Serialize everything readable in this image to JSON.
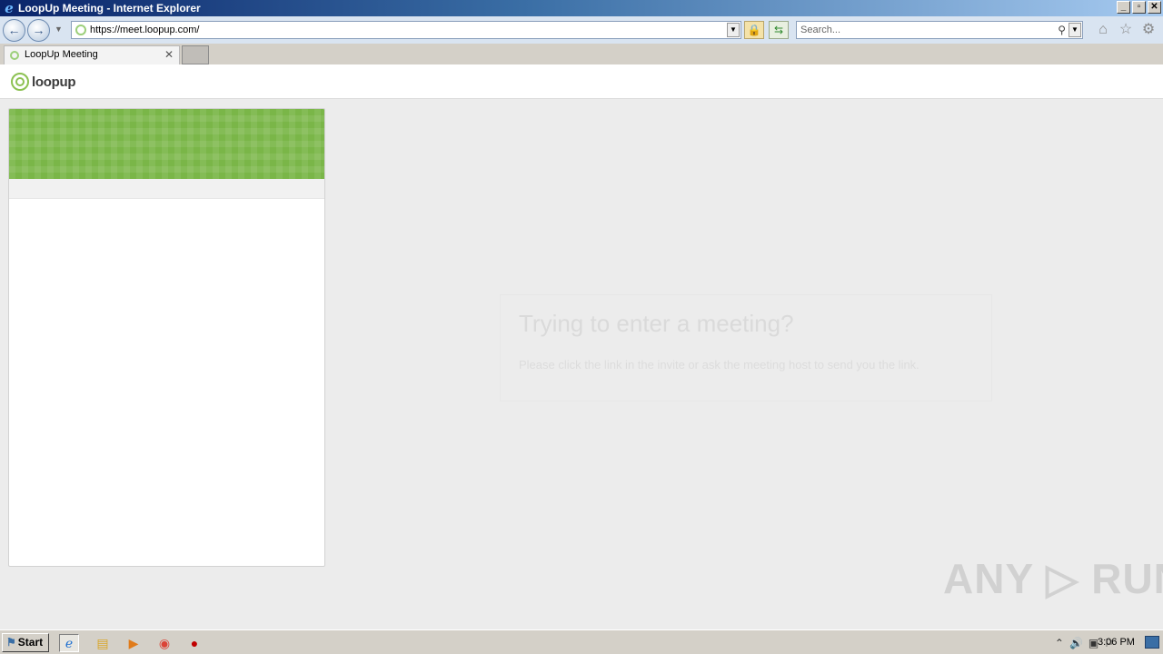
{
  "window": {
    "title": "LoopUp Meeting - Internet Explorer",
    "controls": [
      "_",
      "▫",
      "✕"
    ]
  },
  "navbar": {
    "url": "https://meet.loopup.com/",
    "search_placeholder": "Search..."
  },
  "tabs": [
    {
      "label": "LoopUp Meeting",
      "active": true
    }
  ],
  "page": {
    "logo_text": "loopup",
    "message": {
      "title": "Trying to enter a meeting?",
      "subtitle": "Please click the link in the invite or ask the meeting host to send you the link."
    },
    "banner_color": "#7ab648"
  },
  "watermark": "ANY ▷ RUN",
  "taskbar": {
    "start_label": "Start",
    "apps": [
      "ie-icon",
      "explorer-icon",
      "media-player-icon",
      "chrome-icon",
      "stop-icon"
    ],
    "clock": "3:06 PM"
  }
}
